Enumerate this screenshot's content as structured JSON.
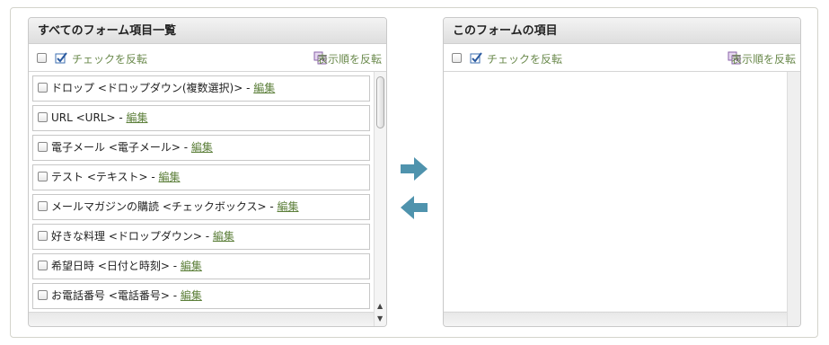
{
  "left_panel": {
    "title": "すべてのフォーム項目一覧",
    "check_toggle_label": "チェックを反転",
    "reverse_order_label": "表示順を反転",
    "items": [
      {
        "text": "ドロップ <ドロップダウン(複数選択)> - ",
        "edit": "編集"
      },
      {
        "text": "URL <URL> - ",
        "edit": "編集"
      },
      {
        "text": "電子メール <電子メール> - ",
        "edit": "編集"
      },
      {
        "text": "テスト <テキスト> - ",
        "edit": "編集"
      },
      {
        "text": "メールマガジンの購読 <チェックボックス> - ",
        "edit": "編集"
      },
      {
        "text": "好きな料理 <ドロップダウン> - ",
        "edit": "編集"
      },
      {
        "text": "希望日時 <日付と時刻> - ",
        "edit": "編集"
      },
      {
        "text": "お電話番号 <電話番号> - ",
        "edit": "編集"
      }
    ]
  },
  "right_panel": {
    "title": "このフォームの項目",
    "check_toggle_label": "チェックを反転",
    "reverse_order_label": "表示順を反転",
    "items": []
  },
  "controls": {
    "add_arrow_icon": "arrow-right-icon",
    "remove_arrow_icon": "arrow-left-icon",
    "arrow_color": "#4a90a8",
    "link_color": "#5c7f3a"
  }
}
